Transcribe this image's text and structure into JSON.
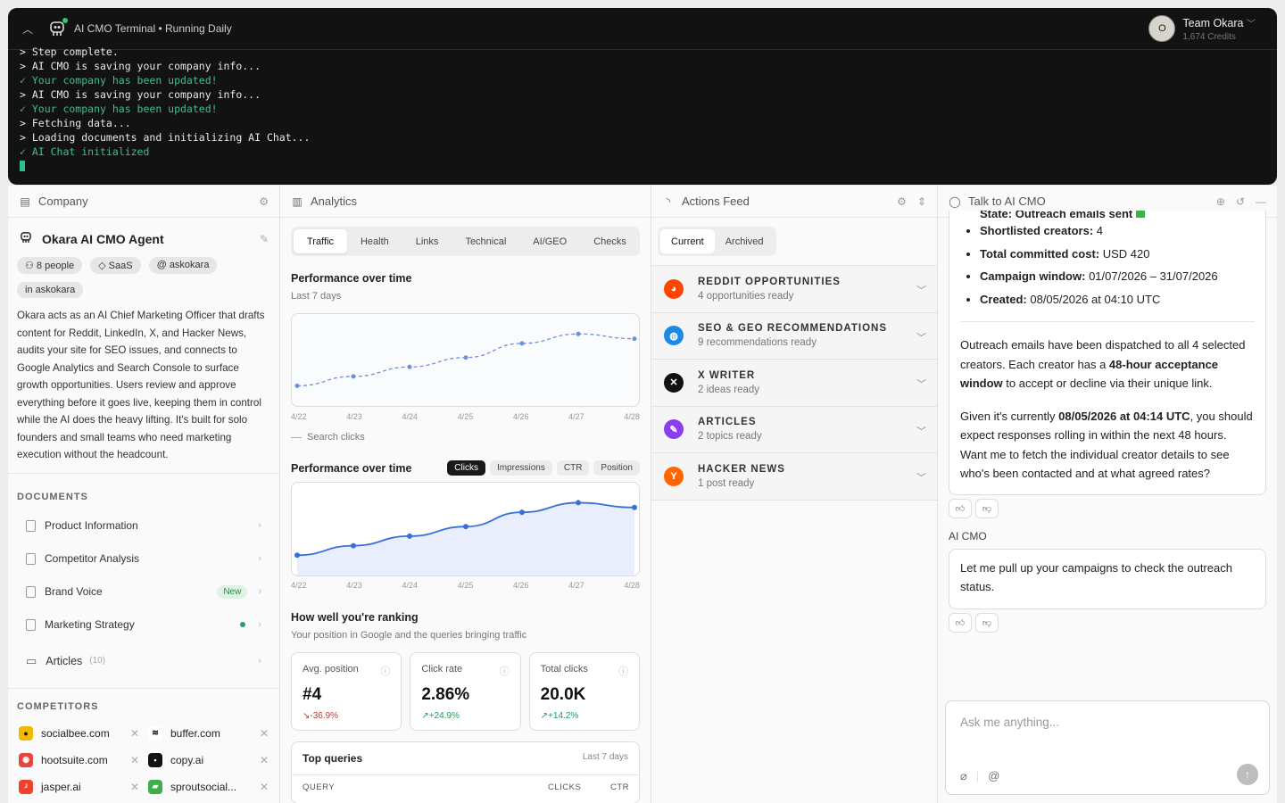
{
  "terminal": {
    "title": "AI CMO Terminal • Running Daily",
    "lines": [
      {
        "text": "> Step complete.",
        "ok": false
      },
      {
        "text": "> AI CMO is saving your company info...",
        "ok": false
      },
      {
        "text": "✓ Your company has been updated!",
        "ok": true
      },
      {
        "text": "> AI CMO is saving your company info...",
        "ok": false
      },
      {
        "text": "✓ Your company has been updated!",
        "ok": true
      },
      {
        "text": "> Fetching data...",
        "ok": false
      },
      {
        "text": "> Loading documents and initializing AI Chat...",
        "ok": false
      },
      {
        "text": "✓ AI Chat initialized",
        "ok": true
      }
    ]
  },
  "account": {
    "initial": "O",
    "name": "Team Okara",
    "credits": "1,674 Credits"
  },
  "company": {
    "header": "Company",
    "agent_name": "Okara AI CMO Agent",
    "chips": [
      "8 people",
      "SaaS",
      "askokara",
      "askokara"
    ],
    "description": "Okara acts as an AI Chief Marketing Officer that drafts content for Reddit, LinkedIn, X, and Hacker News, audits your site for SEO issues, and connects to Google Analytics and Search Console to surface growth opportunities. Users review and approve everything before it goes live, keeping them in control while the AI does the heavy lifting. It's built for solo founders and small teams who need marketing execution without the headcount.",
    "documents_title": "DOCUMENTS",
    "documents": [
      "Product Information",
      "Competitor Analysis",
      "Brand Voice",
      "Marketing Strategy"
    ],
    "new_badge": "New",
    "articles_label": "Articles",
    "articles_count": "(10)",
    "competitors_title": "COMPETITORS",
    "competitors": [
      "socialbee.com",
      "buffer.com",
      "hootsuite.com",
      "copy.ai",
      "jasper.ai",
      "sproutsocial..."
    ]
  },
  "analytics": {
    "header": "Analytics",
    "tabs": [
      "Traffic",
      "Health",
      "Links",
      "Technical",
      "AI/GEO",
      "Checks"
    ],
    "chart1_title": "Performance over time",
    "chart1_sub": "Last 7 days",
    "chart1_legend": "Search clicks",
    "chart2_title": "Performance over time",
    "chart2_pills": [
      "Clicks",
      "Impressions",
      "CTR",
      "Position"
    ],
    "ranking_title": "How well you're ranking",
    "ranking_sub": "Your position in Google and the queries bringing traffic",
    "stats": [
      {
        "label": "Avg. position",
        "value": "#4",
        "delta": "-36.9%"
      },
      {
        "label": "Click rate",
        "value": "2.86%",
        "delta": "+24.9%"
      },
      {
        "label": "Total clicks",
        "value": "20.0K",
        "delta": "+14.2%"
      }
    ],
    "top_queries": "Top queries",
    "top_queries_range": "Last 7 days",
    "cols": [
      "QUERY",
      "CLICKS",
      "CTR"
    ]
  },
  "chart_data": [
    {
      "type": "line",
      "title": "Performance over time",
      "series": [
        {
          "name": "Search clicks",
          "values": [
            2,
            4,
            6,
            8,
            11,
            13,
            12
          ]
        }
      ],
      "categories": [
        "4/22",
        "4/23",
        "4/24",
        "4/25",
        "4/26",
        "4/27",
        "4/28"
      ]
    },
    {
      "type": "area",
      "title": "Performance over time",
      "series": [
        {
          "name": "Clicks",
          "values": [
            2,
            4,
            6,
            8,
            11,
            13,
            12
          ]
        }
      ],
      "categories": [
        "4/22",
        "4/23",
        "4/24",
        "4/25",
        "4/26",
        "4/27",
        "4/28"
      ]
    }
  ],
  "feed": {
    "header": "Actions Feed",
    "seg": [
      "Current",
      "Archived"
    ],
    "items": [
      {
        "title": "REDDIT OPPORTUNITIES",
        "sub": "4 opportunities ready",
        "color": "#ff4500",
        "icon": "reddit-icon",
        "glyph": "◕"
      },
      {
        "title": "SEO & GEO RECOMMENDATIONS",
        "sub": "9 recommendations ready",
        "color": "#1e88e5",
        "icon": "globe-icon",
        "glyph": "◍"
      },
      {
        "title": "X WRITER",
        "sub": "2 ideas ready",
        "color": "#111111",
        "icon": "x-icon",
        "glyph": "✕"
      },
      {
        "title": "ARTICLES",
        "sub": "2 topics ready",
        "color": "#8b3df0",
        "icon": "pen-icon",
        "glyph": "✎"
      },
      {
        "title": "HACKER NEWS",
        "sub": "1 post ready",
        "color": "#ff6600",
        "icon": "hn-icon",
        "glyph": "Y"
      }
    ]
  },
  "chat": {
    "header": "Talk to AI CMO",
    "cut_line": "State: Outreach emails sent",
    "facts": [
      {
        "k": "Shortlisted creators:",
        "v": " 4"
      },
      {
        "k": "Total committed cost:",
        "v": " USD 420"
      },
      {
        "k": "Campaign window:",
        "v": " 01/07/2026 – 31/07/2026"
      },
      {
        "k": "Created:",
        "v": " 08/05/2026 at 04:10 UTC"
      }
    ],
    "p1a": "Outreach emails have been dispatched to all 4 selected creators. Each creator has a ",
    "p1b": "48-hour acceptance window",
    "p1c": " to accept or decline via their unique link.",
    "p2a": "Given it's currently ",
    "p2b": "08/05/2026 at 04:14 UTC",
    "p2c": ", you should expect responses rolling in within the next 48 hours. Want me to fetch the individual creator details to see who's been contacted and at what agreed rates?",
    "sender": "AI CMO",
    "msg2": "Let me pull up your campaigns to check the outreach status.",
    "placeholder": "Ask me anything..."
  }
}
